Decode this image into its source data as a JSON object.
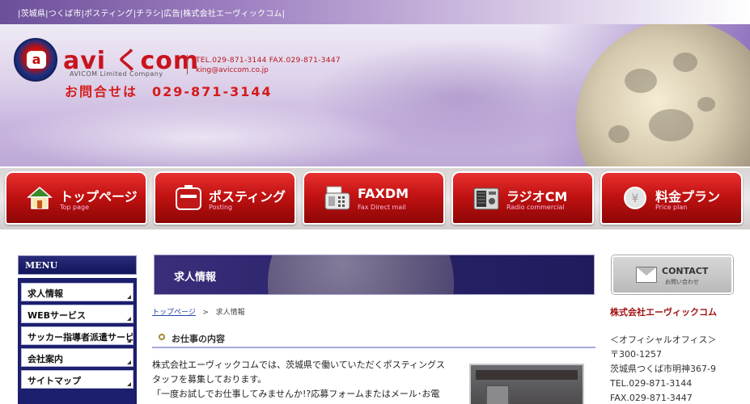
{
  "topbar": {
    "text": "|茨城県|つくば市|ポスティング|チラシ|広告|株式会社エーヴィックコム|"
  },
  "header": {
    "logo_letter": "a",
    "logo_text": "avi くcom",
    "logo_sub": "AVICOM Limited Company",
    "tel": "TEL.029-871-3144 FAX.029-871-3447",
    "mail": "king@aviccom.co.jp",
    "inquiry": "お問合せは　029-871-3144"
  },
  "nav": [
    {
      "label": "トップページ",
      "sub": "Top page",
      "icon": "house-icon"
    },
    {
      "label": "ポスティング",
      "sub": "Posting",
      "icon": "mailbox-icon"
    },
    {
      "label": "FAXDM",
      "sub": "Fax Direct mail",
      "icon": "fax-icon"
    },
    {
      "label": "ラジオCM",
      "sub": "Radio commercial",
      "icon": "radio-icon"
    },
    {
      "label": "料金プラン",
      "sub": "Price plan",
      "icon": "yen-coin-icon"
    }
  ],
  "menu": {
    "title": "MENU",
    "items": [
      "求人情報",
      "WEBサービス",
      "サッカー指導者派遣サービス",
      "会社案内",
      "サイトマップ"
    ]
  },
  "main": {
    "banner_title": "求人情報",
    "breadcrumb_home": "トップページ",
    "breadcrumb_sep": ">",
    "breadcrumb_current": "求人情報",
    "section_title": "お仕事の内容",
    "paragraph1": "株式会社エーヴィックコムでは、茨城県で働いていただくポスティングスタッフを募集しております。",
    "paragraph2": "「一度お試しでお仕事してみませんか!?応募フォームまたはメール･お電"
  },
  "sidebar": {
    "contact_title": "CONTACT",
    "contact_sub": "お問い合わせ",
    "company": "株式会社エーヴィックコム",
    "office": "＜オフィシャルオフィス＞",
    "zip": "〒300-1257",
    "address": "茨城県つくば市明神367-9",
    "tel": "TEL.029-871-3144",
    "fax": "FAX.029-871-3447"
  }
}
